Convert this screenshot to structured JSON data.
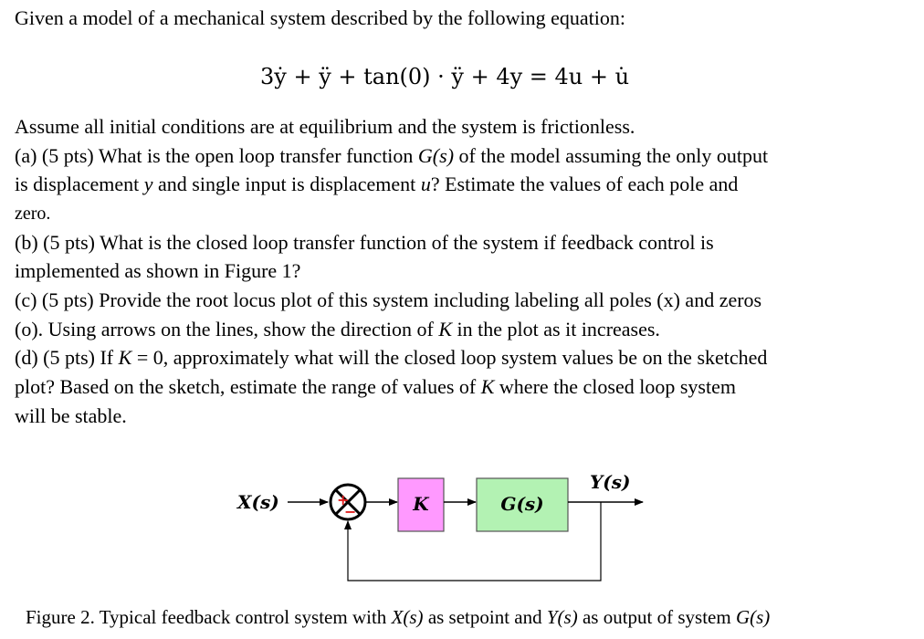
{
  "intro": "Given a model of a mechanical system described by the following equation:",
  "equation": "3ẏ + ÿ + tan(0) · ÿ + 4y = 4u + u̇",
  "assumption": "Assume all initial conditions are at equilibrium and the system is frictionless.",
  "parts": {
    "a1": "(a) (5 pts) What is the open loop transfer function ",
    "a1_italic": "G(s)",
    "a1_end": " of the model assuming the only output",
    "a2": "is displacement ",
    "a2_y": "y",
    "a2_mid": " and single input is displacement ",
    "a2_u": "u",
    "a2_end": "? Estimate the values of each pole and",
    "a3": "zero.",
    "b1": "(b) (5 pts) What is the closed loop transfer function of the system if feedback control is",
    "b2": "implemented as shown in Figure 1?",
    "c1": "(c) (5 pts) Provide the root locus plot of this system including labeling all poles (x) and zeros",
    "c2": "(o). Using arrows on the lines, show the direction of ",
    "c2_k": "K",
    "c2_end": " in the plot as it increases.",
    "d1": "(d) (5 pts) If ",
    "d1_k": "K",
    "d1_end": " = 0, approximately what will the closed loop system values be on the sketched",
    "d2": "plot?  Based on the sketch, estimate the range of values of ",
    "d2_k": "K",
    "d2_end": " where the closed loop system",
    "d3": "will be stable."
  },
  "diagram": {
    "input_label": "X(s)",
    "sum_plus": "+",
    "sum_minus": "−",
    "gain_label": "K",
    "plant_label": "G(s)",
    "output_label": "Y(s)",
    "colors": {
      "gain_fill": "#ff99ff",
      "plant_fill": "#b3f2b3",
      "sign": "#e02020"
    }
  },
  "caption": {
    "pre": "Figure 2. Typical feedback control system with ",
    "x": "X(s)",
    "mid": " as setpoint and ",
    "y": "Y(s)",
    "post": " as output of system ",
    "g": "G(s)"
  }
}
